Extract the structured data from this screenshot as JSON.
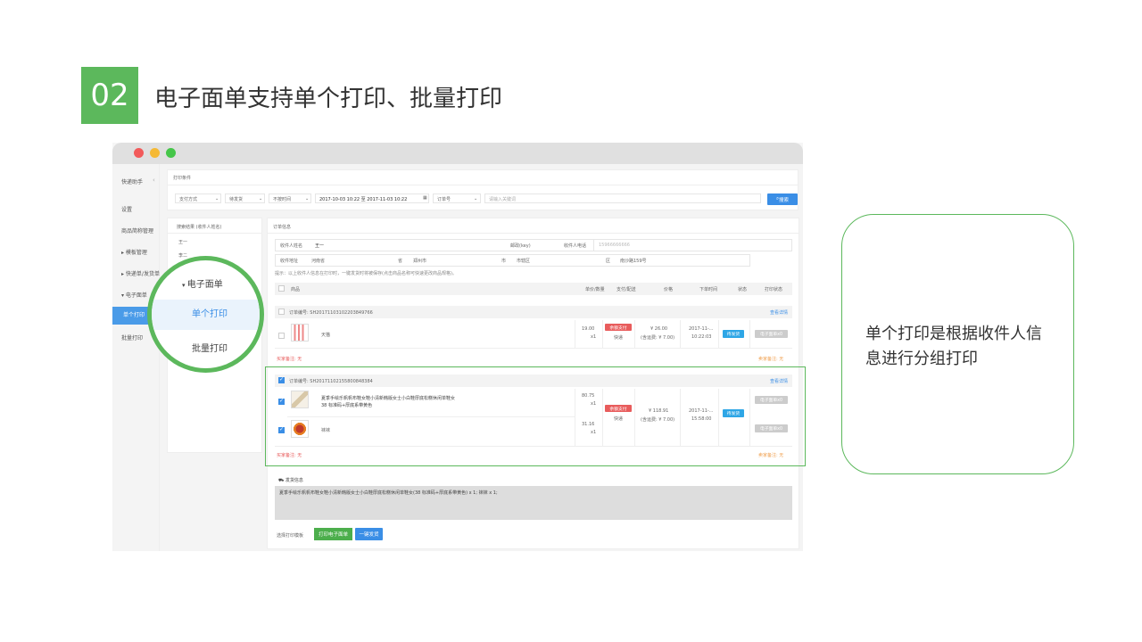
{
  "slide": {
    "number": "02",
    "title": "电子面单支持单个打印、批量打印",
    "callout": "单个打印是根据收件人信息进行分组打印"
  },
  "sidebar": {
    "title": "快递助手",
    "items": [
      "设置",
      "商品简称管理",
      "模板管理",
      "快递单/发货单",
      "电子面单",
      "单个打印",
      "批量打印"
    ]
  },
  "filters": {
    "section_title": "打印条件",
    "payment": "支付方式",
    "ship_status": "待发货",
    "time_filter": "不按时间",
    "date_range": "2017-10-03 10:22 至 2017-11-03 10:22",
    "order_field": "订单号",
    "keyword_placeholder": "请输入关键词",
    "search_button": "搜索"
  },
  "results": {
    "title": "搜索结果 (收件人姓名)",
    "names": [
      "王一",
      "李二"
    ]
  },
  "order_info": {
    "title": "订单信息",
    "recipient_label": "收件人姓名",
    "recipient": "王一",
    "postcode_label": "邮政(key)",
    "phone_label": "收件人电话",
    "phone": "15966666666",
    "address_label": "收件地址",
    "province": "河南省",
    "province_unit": "省",
    "city": "郑州市",
    "city_unit": "市",
    "district": "市辖区",
    "district_unit": "区",
    "street": "南沙路159号",
    "tip": "提示：以上收件人信息在打印时，一键发货时将被保存(点击商品名称可快速更改商品规格)。",
    "columns": [
      "商品",
      "单价/数量",
      "支付/配送",
      "价格",
      "下单时间",
      "状态",
      "打印状态"
    ]
  },
  "orders": [
    {
      "order_no": "订单编号: SH20171103102203849766",
      "detail_link": "查看详情",
      "items": [
        {
          "name": "天猫",
          "price": "19.00",
          "qty": "x1"
        }
      ],
      "pay_tag": "余额支付",
      "ship": "快递",
      "total": "¥ 26.00",
      "freight": "(含运费: ¥ 7.00)",
      "time": "2017-11-...",
      "time2": "10:22:03",
      "status": "待发货",
      "print_status": "电子面单x0",
      "buyer_note": "买家备注: 无",
      "seller_note": "卖家备注: 无"
    },
    {
      "order_no": "订单编号: SH20171102155800848384",
      "detail_link": "查看详情",
      "items": [
        {
          "name": "夏季手绘乐帆帆布鞋女鞋小清新韩版女士小白鞋厚底松糕休闲单鞋女",
          "name2": "38 标准码+厚底系带黄色",
          "price": "80.75",
          "qty": "x1"
        },
        {
          "name": "袜袜",
          "price": "31.16",
          "qty": "x1"
        }
      ],
      "pay_tag": "余额支付",
      "ship": "快递",
      "total": "¥ 118.91",
      "freight": "(含运费: ¥ 7.00)",
      "time": "2017-11-...",
      "time2": "15:58:00",
      "status": "待发货",
      "print_status": "电子面单x0",
      "buyer_note": "买家备注: 无",
      "seller_note": "卖家备注: 无"
    }
  ],
  "shipping": {
    "title": "发货信息",
    "text": "夏季手绘乐帆帆布鞋女鞋小清新韩版女士小白鞋厚底松糕休闲单鞋女(38 标准码+厚底系带黄色) x 1; 袜袜 x 1;",
    "template_label": "选择打印模板",
    "print_button": "打印电子面单",
    "ship_button": "一键发货"
  },
  "zoom": {
    "header": "电子面单",
    "active": "单个打印",
    "other": "批量打印"
  },
  "colors": {
    "accent_green": "#5cb85c",
    "accent_blue": "#3a8ee6",
    "tag_red": "#e85c5c"
  }
}
